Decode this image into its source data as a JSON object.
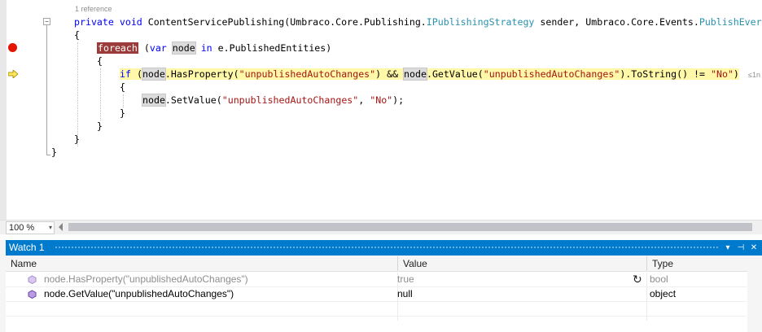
{
  "editor": {
    "codelens": "1 reference",
    "line1": {
      "kw1": "private",
      "kw2": "void",
      "t1": " ContentServicePublishing(Umbraco.Core.Publishing.",
      "ty1": "IPublishingStrategy",
      "t2": " sender, Umbraco.Core.Events.",
      "ty2": "PublishEver"
    },
    "brace_open": "{",
    "brace_close": "}",
    "line_foreach": {
      "kw": "foreach",
      "t1": " (",
      "kw2": "var",
      "t2": " ",
      "node": "node",
      "t3": " ",
      "kw3": "in",
      "t4": " e.PublishedEntities)"
    },
    "line_if": {
      "kw": "if",
      "t1": " (",
      "node1": "node",
      "t2": ".HasProperty(",
      "s1": "\"unpublishedAutoChanges\"",
      "t3": ") && ",
      "node2": "node",
      "t4": ".GetValue(",
      "s2": "\"unpublishedAutoChanges\"",
      "t5": ").ToString() != ",
      "s3": "\"No\"",
      "t6": ")",
      "perf": "≤1n"
    },
    "line_set": {
      "node": "node",
      "t1": ".SetValue(",
      "s1": "\"unpublishedAutoChanges\"",
      "t2": ", ",
      "s2": "\"No\"",
      "t3": ");"
    }
  },
  "zoom": {
    "value": "100 %"
  },
  "watch": {
    "title": "Watch 1",
    "title_buttons": [
      "▾",
      "⊣",
      "✕"
    ],
    "columns": [
      "Name",
      "Value",
      "Type"
    ],
    "rows": [
      {
        "name": "node.HasProperty(\"unpublishedAutoChanges\")",
        "value": "true",
        "type": "bool",
        "stale": true
      },
      {
        "name": "node.GetValue(\"unpublishedAutoChanges\")",
        "value": "null",
        "type": "object",
        "stale": false
      }
    ]
  },
  "colors": {
    "accent": "#007acc",
    "breakpoint": "#e51400",
    "current_line": "#fff8a8"
  },
  "icons": [
    "breakpoint-icon",
    "current-statement-arrow-icon",
    "collapse-icon",
    "watch-item-icon",
    "refresh-icon"
  ]
}
